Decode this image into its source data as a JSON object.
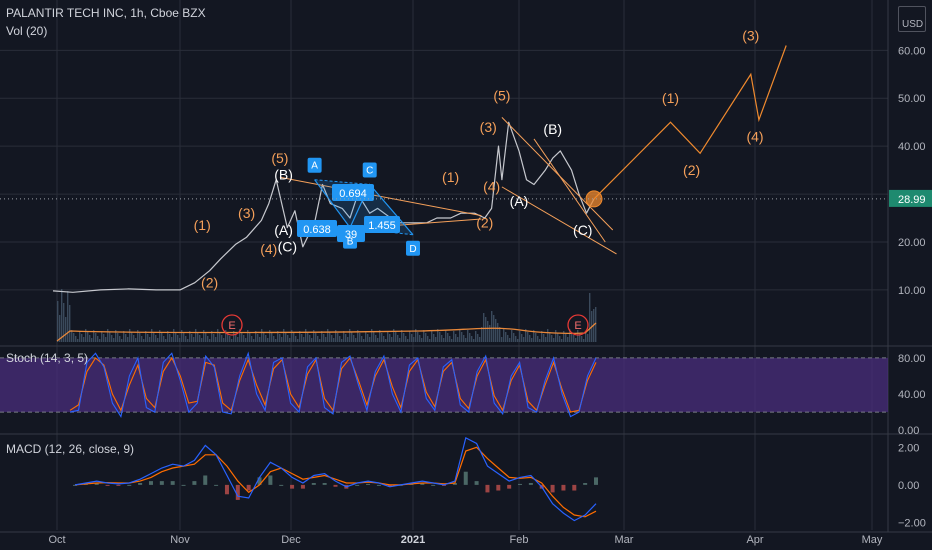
{
  "header": {
    "symbol": "PALANTIR TECH INC, 1h, Cboe BZX",
    "volume_label": "Vol (20)",
    "currency_top": " ",
    "currency": "USD"
  },
  "colors": {
    "background": "#131722",
    "grid": "#2a2e39",
    "axis_text": "#b2b5be",
    "price_line": "#c6c8ce",
    "wave_orange": "#f5a05a",
    "wave_white": "#ffffff",
    "marker_blue": "#2196f3",
    "stoch_band": "#4a2d7c",
    "stoch_k": "#2962ff",
    "stoch_d": "#ff6d00",
    "macd_line": "#2962ff",
    "signal_line": "#ff6d00",
    "earnings": "#e53935"
  },
  "chart_data": [
    {
      "type": "line",
      "title": "PALANTIR TECH INC, 1h, Cboe BZX",
      "y_axis": {
        "ticks": [
          10,
          20,
          30,
          40,
          50,
          60
        ],
        "tick_labels": [
          "10.00",
          "20.00",
          "30.00",
          "40.00",
          "50.00",
          "60.00"
        ],
        "ylim": [
          -1.5,
          70.5
        ]
      },
      "x_axis": {
        "ticks": [
          "Oct",
          "Nov",
          "Dec",
          "2021",
          "Feb",
          "Mar",
          "Apr",
          "May"
        ]
      },
      "last_price": 28.99,
      "last_price_label": "28.99",
      "series": [
        {
          "x": [
            "2020-09-30",
            "2020-10-05",
            "2020-10-12",
            "2020-10-19",
            "2020-10-26",
            "2020-11-01",
            "2020-11-05",
            "2020-11-09",
            "2020-11-12",
            "2020-11-16",
            "2020-11-19",
            "2020-11-23",
            "2020-11-25",
            "2020-11-27",
            "2020-11-30",
            "2020-12-02",
            "2020-12-04",
            "2020-12-07",
            "2020-12-09",
            "2020-12-11",
            "2020-12-14",
            "2020-12-16",
            "2020-12-18",
            "2020-12-21",
            "2020-12-23",
            "2020-12-28",
            "2021-01-01",
            "2021-01-05",
            "2021-01-08",
            "2021-01-12",
            "2021-01-15",
            "2021-01-19",
            "2021-01-22",
            "2021-01-24",
            "2021-01-26",
            "2021-01-27",
            "2021-01-29",
            "2021-02-01",
            "2021-02-03",
            "2021-02-05",
            "2021-02-08",
            "2021-02-10",
            "2021-02-12",
            "2021-02-15",
            "2021-02-17",
            "2021-02-19",
            "2021-02-21"
          ],
          "values": [
            9.8,
            9.5,
            10.0,
            10.2,
            10.0,
            10.0,
            11.5,
            14.0,
            16.5,
            19.5,
            21.0,
            24.5,
            28.0,
            33.0,
            23.0,
            26.5,
            19.0,
            24.0,
            32.0,
            28.0,
            27.0,
            25.0,
            30.0,
            26.0,
            27.0,
            24.0,
            24.0,
            24.0,
            25.0,
            25.0,
            26.0,
            26.0,
            25.0,
            27.0,
            40.0,
            33.0,
            45.0,
            39.0,
            33.0,
            32.0,
            35.0,
            37.5,
            39.0,
            35.0,
            30.0,
            26.0,
            28.99
          ]
        }
      ],
      "volume_earnings_markers": [
        "E",
        "E"
      ],
      "elliott_waves_orange": [
        {
          "label": "(1)",
          "x": "2020-11-07",
          "y": 22.5
        },
        {
          "label": "(2)",
          "x": "2020-11-09",
          "y": 10.5
        },
        {
          "label": "(3)",
          "x": "2020-11-19",
          "y": 25.0
        },
        {
          "label": "(4)",
          "x": "2020-11-25",
          "y": 17.5
        },
        {
          "label": "(5)",
          "x": "2020-11-28",
          "y": 36.5
        },
        {
          "label": "(1)",
          "x": "2021-01-12",
          "y": 32.5
        },
        {
          "label": "(2)",
          "x": "2021-01-22",
          "y": 23.0
        },
        {
          "label": "(3)",
          "x": "2021-01-23",
          "y": 43.0
        },
        {
          "label": "(4)",
          "x": "2021-01-24",
          "y": 30.5
        },
        {
          "label": "(5)",
          "x": "2021-01-27",
          "y": 49.5
        },
        {
          "label": "(1)",
          "x": "2021-03-12",
          "y": 49.0
        },
        {
          "label": "(2)",
          "x": "2021-03-17",
          "y": 34.0
        },
        {
          "label": "(3)",
          "x": "2021-03-31",
          "y": 62.0
        },
        {
          "label": "(4)",
          "x": "2021-04-01",
          "y": 41.0
        },
        {
          "label": "(5)",
          "x": "2021-04-09",
          "y": 75.0
        }
      ],
      "elliott_waves_white": [
        {
          "label": "(B)",
          "x": "2020-11-29",
          "y": 33.0
        },
        {
          "label": "(A)",
          "x": "2020-11-29",
          "y": 21.5
        },
        {
          "label": "(C)",
          "x": "2020-11-30",
          "y": 18.0
        },
        {
          "label": "(A)",
          "x": "2021-02-01",
          "y": 27.5
        },
        {
          "label": "(B)",
          "x": "2021-02-10",
          "y": 42.5
        },
        {
          "label": "(C)",
          "x": "2021-02-18",
          "y": 21.5
        }
      ],
      "abcd_pattern": {
        "points": [
          {
            "label": "A",
            "x": "2020-12-07",
            "y": 33.0
          },
          {
            "label": "B",
            "x": "2020-12-16",
            "y": 23.0
          },
          {
            "label": "C",
            "x": "2020-12-21",
            "y": 32.0
          },
          {
            "label": "D",
            "x": "2021-01-01",
            "y": 21.5
          }
        ],
        "ratios": [
          "0.694",
          "0.638",
          "39",
          "1.455"
        ]
      },
      "trendlines": [
        {
          "from": [
            "2020-11-28",
            33.5
          ],
          "to": [
            "2021-01-21",
            25.5
          ]
        },
        {
          "from": [
            "2020-12-04",
            22.0
          ],
          "to": [
            "2021-01-21",
            24.8
          ]
        },
        {
          "from": [
            "2021-01-27",
            46.0
          ],
          "to": [
            "2021-02-26",
            22.5
          ]
        },
        {
          "from": [
            "2021-01-27",
            31.5
          ],
          "to": [
            "2021-02-27",
            17.5
          ]
        },
        {
          "from": [
            "2021-02-05",
            41.5
          ],
          "to": [
            "2021-02-24",
            20.0
          ]
        }
      ],
      "projection": [
        {
          "x": "2021-02-21",
          "y": 28.99
        },
        {
          "x": "2021-03-12",
          "y": 45.0
        },
        {
          "x": "2021-03-19",
          "y": 38.5
        },
        {
          "x": "2021-03-31",
          "y": 55.0
        },
        {
          "x": "2021-04-02",
          "y": 45.5
        },
        {
          "x": "2021-04-09",
          "y": 61.0
        }
      ]
    },
    {
      "type": "line",
      "title": "Stoch (14, 3, 5)",
      "y_axis": {
        "ticks": [
          0,
          40,
          80
        ],
        "tick_labels": [
          "0.00",
          "40.00",
          "80.00"
        ],
        "ylim": [
          -2,
          92
        ]
      },
      "bands": [
        20,
        80
      ],
      "series": [
        {
          "name": "%K",
          "values": [
            20,
            22,
            75,
            85,
            70,
            30,
            15,
            60,
            80,
            25,
            20,
            75,
            85,
            55,
            20,
            30,
            82,
            70,
            20,
            18,
            60,
            85,
            40,
            22,
            75,
            80,
            30,
            20,
            70,
            80,
            25,
            18,
            75,
            82,
            50,
            22,
            65,
            82,
            40,
            20,
            72,
            80,
            35,
            22,
            70,
            78,
            28,
            20,
            65,
            82,
            30,
            18,
            60,
            75,
            25,
            20,
            55,
            80,
            40,
            15,
            20,
            60,
            80
          ]
        },
        {
          "name": "%D",
          "values": [
            22,
            28,
            65,
            80,
            72,
            40,
            22,
            50,
            72,
            35,
            25,
            65,
            80,
            60,
            30,
            32,
            75,
            72,
            30,
            22,
            55,
            78,
            50,
            28,
            68,
            78,
            40,
            25,
            62,
            78,
            35,
            22,
            68,
            80,
            55,
            28,
            60,
            78,
            48,
            25,
            65,
            78,
            42,
            26,
            65,
            75,
            35,
            24,
            60,
            78,
            38,
            22,
            55,
            72,
            32,
            22,
            50,
            75,
            45,
            20,
            22,
            55,
            75
          ]
        }
      ]
    },
    {
      "type": "line",
      "title": "MACD (12, 26, close, 9)",
      "y_axis": {
        "ticks": [
          -2,
          0,
          2
        ],
        "tick_labels": [
          "−2.00",
          "0.00",
          "2.00"
        ],
        "ylim": [
          -2.4,
          2.6
        ]
      },
      "series": [
        {
          "name": "MACD",
          "values": [
            0,
            0.1,
            0.2,
            0.1,
            0.05,
            0.1,
            0.3,
            0.6,
            0.9,
            1.1,
            1.0,
            1.3,
            2.1,
            1.6,
            0.5,
            -0.6,
            -0.7,
            0.4,
            1.2,
            0.9,
            0.4,
            0.1,
            0.5,
            0.6,
            0.2,
            -0.1,
            0.1,
            0.2,
            0.1,
            -0.1,
            0.0,
            0.1,
            0.2,
            0.1,
            0.0,
            0.2,
            2.5,
            2.2,
            1.0,
            0.6,
            0.2,
            0.4,
            0.5,
            -0.1,
            -1.0,
            -1.5,
            -1.9,
            -1.6,
            -1.0
          ]
        },
        {
          "name": "Signal",
          "values": [
            0,
            0.05,
            0.1,
            0.12,
            0.1,
            0.1,
            0.2,
            0.4,
            0.7,
            0.9,
            1.0,
            1.1,
            1.6,
            1.6,
            1.0,
            0.2,
            -0.4,
            0.0,
            0.7,
            0.9,
            0.6,
            0.3,
            0.4,
            0.5,
            0.3,
            0.1,
            0.1,
            0.15,
            0.1,
            0.0,
            0.0,
            0.05,
            0.1,
            0.1,
            0.05,
            0.1,
            1.8,
            2.0,
            1.4,
            0.9,
            0.4,
            0.35,
            0.4,
            0.1,
            -0.6,
            -1.2,
            -1.6,
            -1.7,
            -1.4
          ]
        }
      ]
    }
  ]
}
